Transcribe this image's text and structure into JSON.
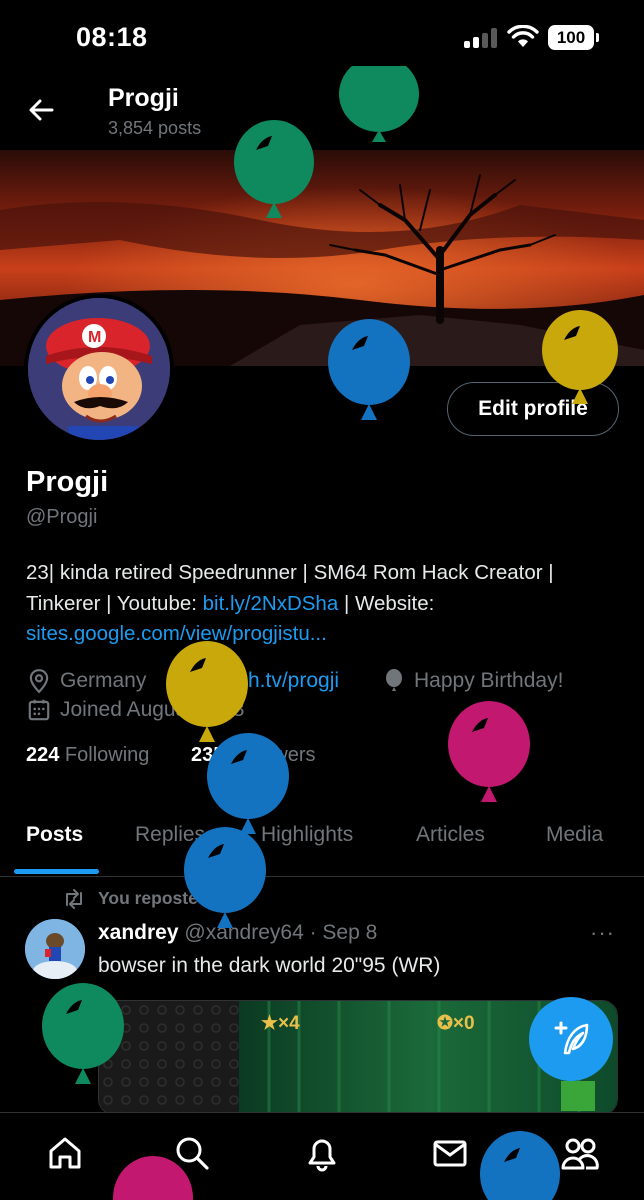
{
  "status_bar": {
    "time": "08:18",
    "battery": "100"
  },
  "header": {
    "name": "Progji",
    "posts_count": "3,854 posts"
  },
  "profile": {
    "edit_label": "Edit profile",
    "display_name": "Progji",
    "handle": "@Progji",
    "bio_line1": "23| kinda retired Speedrunner | SM64 Rom Hack Creator |",
    "bio_line2_prefix": "Tinkerer | Youtube: ",
    "bio_youtube_link": "bit.ly/2NxDSha",
    "bio_line2_suffix": " | Website:",
    "bio_website_link": "sites.google.com/view/progjistu...",
    "location": "Germany",
    "twitch_link": "twitch.tv/progji",
    "birthday": "Happy Birthday!",
    "joined": "Joined August 2018",
    "following_count": "224",
    "following_label": " Following",
    "followers_count": "235",
    "followers_label": " Followers"
  },
  "tabs": [
    "Posts",
    "Replies",
    "Highlights",
    "Articles",
    "Media"
  ],
  "post": {
    "repost_label": "You reposted",
    "author_name": "xandrey",
    "author_meta": " @xandrey64 · Sep 8",
    "more": "···",
    "text": "bowser in the dark world 20\"95 (WR)",
    "hud_left": "★×4",
    "hud_right": "✪×0"
  },
  "colors": {
    "accent": "#1d9bf0",
    "balloon_green": "#0f8a5f",
    "balloon_blue": "#1473c0",
    "balloon_yellow": "#c9a80c",
    "balloon_magenta": "#c2186f"
  },
  "icons": {
    "back": "arrow-left-icon",
    "location": "map-pin-icon",
    "link": "link-icon",
    "birthday": "balloon-icon",
    "calendar": "calendar-icon",
    "repost": "repost-icon",
    "compose": "feather-plus-icon",
    "home": "home-icon",
    "search": "search-icon",
    "notifications": "bell-icon",
    "messages": "mail-icon",
    "communities": "people-icon"
  }
}
